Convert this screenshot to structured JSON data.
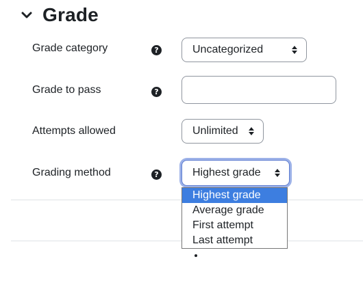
{
  "section": {
    "title": "Grade",
    "collapse_icon": "chevron-down-icon"
  },
  "fields": {
    "grade_category": {
      "label": "Grade category",
      "help_icon": "question-circle-icon",
      "value": "Uncategorized"
    },
    "grade_to_pass": {
      "label": "Grade to pass",
      "help_icon": "question-circle-icon",
      "value": ""
    },
    "attempts_allowed": {
      "label": "Attempts allowed",
      "value": "Unlimited"
    },
    "grading_method": {
      "label": "Grading method",
      "help_icon": "question-circle-icon",
      "value": "Highest grade",
      "options": [
        "Highest grade",
        "Average grade",
        "First attempt",
        "Last attempt"
      ],
      "highlighted_option": "Highest grade"
    }
  },
  "colors": {
    "highlight": "#3d7ee0",
    "focus_ring": "#9db2e8",
    "text": "#1d2125"
  }
}
